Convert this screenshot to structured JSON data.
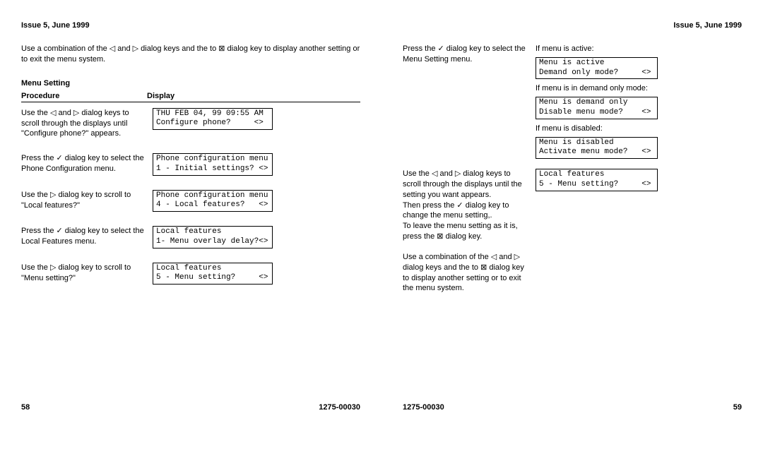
{
  "issue": "Issue 5, June 1999",
  "docnum": "1275-00030",
  "pageL": "58",
  "pageR": "59",
  "introL": "Use a combination of the ◁ and ▷ dialog keys and the to ⊠ dialog key to display another setting or to exit the menu system.",
  "menuSettingTitle": "Menu Setting",
  "hdrProc": "Procedure",
  "hdrDisp": "Display",
  "r1p": "Use the ◁ and ▷ dialog keys to scroll through the displays until \"Configure phone?\" appears.",
  "r1d": "THU FEB 04, 99 09:55 AM\nConfigure phone?     <>",
  "r2p": "Press the ✓ dialog key to select the Phone Configuration menu.",
  "r2d": "Phone configuration menu\n1 - Initial settings? <>",
  "r3p": "Use the ▷ dialog key to scroll to \"Local features?\"",
  "r3d": "Phone configuration menu\n4 - Local features?   <>",
  "r4p": "Press the ✓ dialog key to select the Local Features menu.",
  "r4d": "Local features\n1- Menu overlay delay?<>",
  "r5p": "Use the ▷ dialog key to scroll to \"Menu setting?\"",
  "r5d": "Local features\n5 - Menu setting?     <>",
  "rc1p": "Press the ✓ dialog key to select the Menu Setting menu.",
  "rc1l1": "If menu is active:",
  "rc1d1": "Menu is active\nDemand only mode?     <>",
  "rc1l2": "If menu is in demand only mode:",
  "rc1d2": "Menu is demand only\nDisable menu mode?    <>",
  "rc1l3": "If menu is disabled:",
  "rc1d3": "Menu is disabled\nActivate menu mode?   <>",
  "rc2p": "Use the ◁ and ▷ dialog keys to scroll through the displays until the setting you want appears.\nThen  press the ✓ dialog key to change the menu setting,.\nTo leave the menu setting as it is, press the ⊠ dialog key.",
  "rc2d": "Local features\n5 - Menu setting?     <>",
  "rc3p": "Use a combination of the ◁ and ▷ dialog keys and the to ⊠ dialog key to display another setting or to exit the menu system."
}
